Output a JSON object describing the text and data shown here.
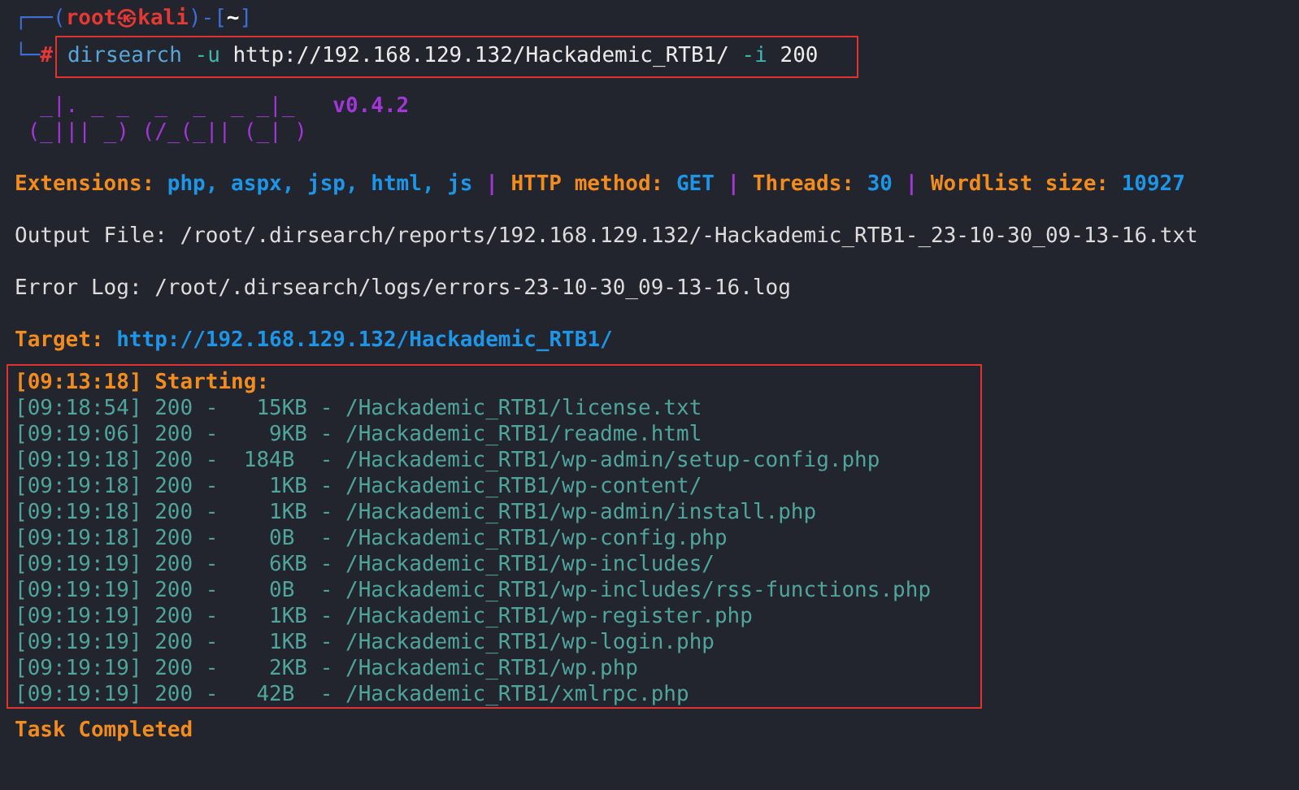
{
  "prompt": [
    {
      "text": "┌──(",
      "kind": "frame"
    },
    {
      "text": "root㉿kali",
      "kind": "user"
    },
    {
      "text": ")-[",
      "kind": "frame"
    },
    {
      "text": "~",
      "kind": "dir"
    },
    {
      "text": "]",
      "kind": "frame"
    }
  ],
  "command_prompt": [
    {
      "text": "└─",
      "kind": "frame"
    },
    {
      "text": "#",
      "kind": "user"
    }
  ],
  "command": [
    {
      "text": "dirsearch",
      "kind": "program"
    },
    {
      "text": "-u",
      "kind": "flag"
    },
    {
      "text": "http://192.168.129.132/Hackademic_RTB1/",
      "kind": "arg"
    },
    {
      "text": "-i",
      "kind": "flag"
    },
    {
      "text": "200",
      "kind": "arg"
    }
  ],
  "banner": {
    "art": [
      "  _|. _ _  _  _  _ _|_",
      " (_||| _) (/_(_|| (_| )"
    ],
    "version": "v0.4.2"
  },
  "settings": [
    {
      "text": "Extensions:",
      "kind": "label"
    },
    {
      "text": "php, aspx, jsp, html, js",
      "kind": "value"
    },
    {
      "text": "|",
      "kind": "sep"
    },
    {
      "text": "HTTP method:",
      "kind": "label"
    },
    {
      "text": "GET",
      "kind": "value"
    },
    {
      "text": "|",
      "kind": "sep"
    },
    {
      "text": "Threads:",
      "kind": "label"
    },
    {
      "text": "30",
      "kind": "value"
    },
    {
      "text": "|",
      "kind": "sep"
    },
    {
      "text": "Wordlist size:",
      "kind": "label"
    },
    {
      "text": "10927",
      "kind": "value"
    }
  ],
  "output_file": "Output File: /root/.dirsearch/reports/192.168.129.132/-Hackademic_RTB1-_23-10-30_09-13-16.txt",
  "error_log": "Error Log: /root/.dirsearch/logs/errors-23-10-30_09-13-16.log",
  "target": {
    "label": "Target:",
    "url": "http://192.168.129.132/Hackademic_RTB1/"
  },
  "scan": {
    "start": "[09:13:18] Starting:",
    "rows": [
      "[09:18:54] 200 -   15KB - /Hackademic_RTB1/license.txt",
      "[09:19:06] 200 -    9KB - /Hackademic_RTB1/readme.html",
      "[09:19:18] 200 -  184B  - /Hackademic_RTB1/wp-admin/setup-config.php",
      "[09:19:18] 200 -    1KB - /Hackademic_RTB1/wp-content/",
      "[09:19:18] 200 -    1KB - /Hackademic_RTB1/wp-admin/install.php",
      "[09:19:18] 200 -    0B  - /Hackademic_RTB1/wp-config.php",
      "[09:19:19] 200 -    6KB - /Hackademic_RTB1/wp-includes/",
      "[09:19:19] 200 -    0B  - /Hackademic_RTB1/wp-includes/rss-functions.php",
      "[09:19:19] 200 -    1KB - /Hackademic_RTB1/wp-register.php",
      "[09:19:19] 200 -    1KB - /Hackademic_RTB1/wp-login.php",
      "[09:19:19] 200 -    2KB - /Hackademic_RTB1/wp.php",
      "[09:19:19] 200 -   42B  - /Hackademic_RTB1/xmlrpc.php"
    ]
  },
  "status": "Task Completed"
}
